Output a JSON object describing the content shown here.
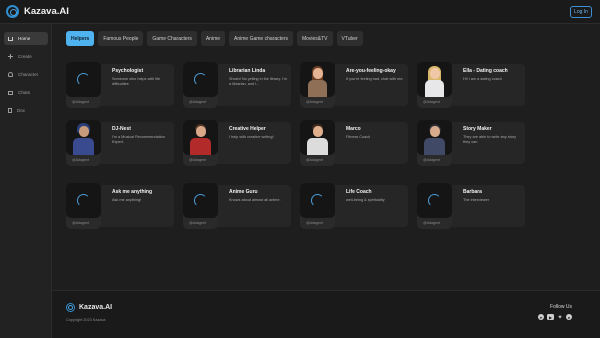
{
  "header": {
    "brand": "Kazava.AI",
    "login_label": "Log In"
  },
  "sidebar": {
    "items": [
      {
        "label": "Home",
        "icon": "home-icon",
        "active": true
      },
      {
        "label": "Create",
        "icon": "plus-icon",
        "active": false
      },
      {
        "label": "Character",
        "icon": "person-icon",
        "active": false
      },
      {
        "label": "Chats",
        "icon": "mail-icon",
        "active": false
      },
      {
        "label": "Doc",
        "icon": "doc-icon",
        "active": false
      }
    ]
  },
  "filters": [
    "Helpers",
    "Famous People",
    "Game Characters",
    "Anime",
    "Anime Game characters",
    "Movies&TV",
    "VTuber"
  ],
  "cards": [
    {
      "title": "Psychologist",
      "desc": "Someone who helps with life difficulties",
      "tag": "@Adagent",
      "thumb": "spinner"
    },
    {
      "title": "Librarian Linda",
      "desc": "Shush! No yelling in the library. I'm a librarian, and I...",
      "tag": "@Adagent",
      "thumb": "spinner"
    },
    {
      "title": "Are-you-feeling-okay",
      "desc": "If you're feeling bad, chat with me.",
      "tag": "@Adagent",
      "thumb": "avatar"
    },
    {
      "title": "Ella - Dating coach",
      "desc": "Hi! I am a dating coach",
      "tag": "@Adagent",
      "thumb": "avatar"
    },
    {
      "title": "DJ-Nest",
      "desc": "I'm a Musical Recommendation Expert.",
      "tag": "@Adagent",
      "thumb": "avatar"
    },
    {
      "title": "Creative Helper",
      "desc": "I help with creative writing!",
      "tag": "@Adagent",
      "thumb": "avatar"
    },
    {
      "title": "Marco",
      "desc": "Fitness Coach",
      "tag": "@Adagent",
      "thumb": "avatar"
    },
    {
      "title": "Story Maker",
      "desc": "They are able to write any story they can",
      "tag": "@Adagent",
      "thumb": "avatar"
    },
    {
      "title": "Ask me anything",
      "desc": "Ask me anything!",
      "tag": "@Adagent",
      "thumb": "spinner"
    },
    {
      "title": "Anime Guru",
      "desc": "Knows about almost all anime.",
      "tag": "@Adagent",
      "thumb": "spinner"
    },
    {
      "title": "Life Coach",
      "desc": "well-being & spirituality",
      "tag": "@Adagent",
      "thumb": "spinner"
    },
    {
      "title": "Barbara",
      "desc": "The interviewer",
      "tag": "@Adagent",
      "thumb": "spinner"
    }
  ],
  "footer": {
    "brand": "Kazava.AI",
    "copyright": "Copyright 2023 Kazava",
    "follow_label": "Follow Us",
    "socials": [
      "telegram-icon",
      "youtube-icon",
      "twitter-icon",
      "reddit-icon"
    ]
  },
  "colors": {
    "accent": "#4fb3ef",
    "background": "#1e1e1e",
    "card": "#262626"
  }
}
